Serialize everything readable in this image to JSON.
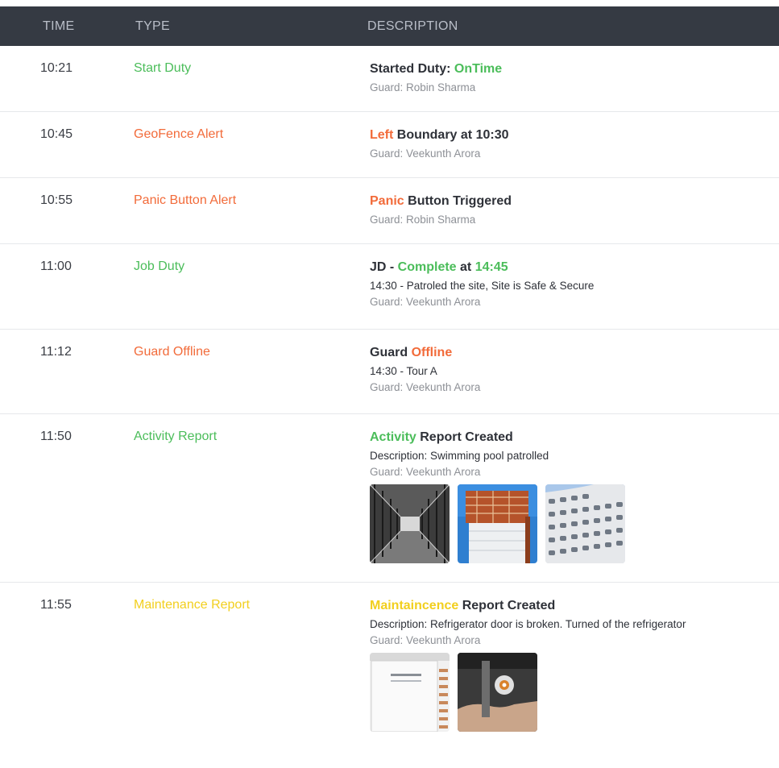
{
  "header": {
    "time": "TIME",
    "type": "TYPE",
    "description": "DESCRIPTION"
  },
  "rows": [
    {
      "time": "10:21",
      "type": "Start Duty",
      "type_color": "green",
      "title_parts": [
        {
          "text": "Started Duty: ",
          "color": "dark"
        },
        {
          "text": "OnTime",
          "color": "green"
        }
      ],
      "guard": "Guard: Robin Sharma"
    },
    {
      "time": "10:45",
      "type": "GeoFence Alert",
      "type_color": "orange",
      "title_parts": [
        {
          "text": "Left",
          "color": "orange"
        },
        {
          "text": " Boundary at 10:30",
          "color": "dark"
        }
      ],
      "guard": "Guard: Veekunth Arora"
    },
    {
      "time": "10:55",
      "type": "Panic Button Alert",
      "type_color": "orange",
      "title_parts": [
        {
          "text": "Panic",
          "color": "orange"
        },
        {
          "text": " Button Triggered",
          "color": "dark"
        }
      ],
      "guard": "Guard: Robin Sharma"
    },
    {
      "time": "11:00",
      "type": "Job Duty",
      "type_color": "green",
      "title_parts": [
        {
          "text": "JD - ",
          "color": "dark"
        },
        {
          "text": "Complete",
          "color": "green"
        },
        {
          "text": " at ",
          "color": "dark"
        },
        {
          "text": "14:45",
          "color": "green"
        }
      ],
      "detail": "14:30 - Patroled the site, Site is Safe & Secure",
      "guard": "Guard: Veekunth Arora"
    },
    {
      "time": "11:12",
      "type": "Guard Offline",
      "type_color": "orange",
      "title_parts": [
        {
          "text": "Guard ",
          "color": "dark"
        },
        {
          "text": "Offline",
          "color": "orange"
        }
      ],
      "detail": "14:30  - Tour A",
      "guard": "Guard: Veekunth Arora"
    },
    {
      "time": "11:50",
      "type": "Activity Report",
      "type_color": "green",
      "title_parts": [
        {
          "text": "Activity",
          "color": "green"
        },
        {
          "text": " Report Created",
          "color": "dark"
        }
      ],
      "detail": "Description: Swimming pool patrolled",
      "guard": "Guard: Veekunth Arora",
      "photos": [
        "scaffold-corridor-photo",
        "construction-building-photo",
        "curved-facade-photo"
      ]
    },
    {
      "time": "11:55",
      "type": "Maintenance Report",
      "type_color": "yellow",
      "title_parts": [
        {
          "text": "Maintaincence",
          "color": "yellow"
        },
        {
          "text": " Report Created",
          "color": "dark"
        }
      ],
      "detail": "Description: Refrigerator door is broken. Turned of the refrigerator",
      "guard": "Guard: Veekunth Arora",
      "photos": [
        "refrigerator-photo",
        "hand-device-photo"
      ]
    }
  ],
  "colors": {
    "green": "#4bbd5a",
    "orange": "#f26b3a",
    "yellow": "#f2cf1e",
    "dark": "#2e3138",
    "header_bg": "#353a43"
  }
}
